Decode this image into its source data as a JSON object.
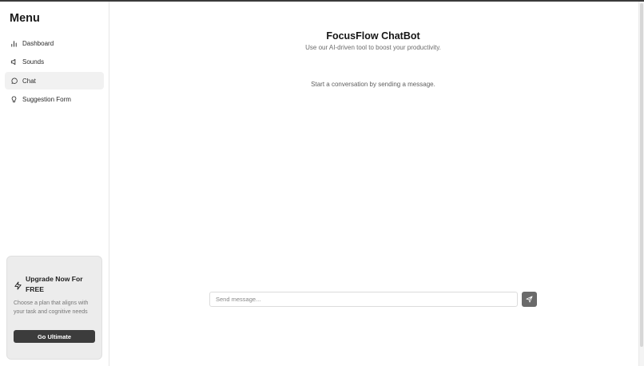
{
  "sidebar": {
    "title": "Menu",
    "items": [
      {
        "label": "Dashboard",
        "icon": "bar-chart-icon"
      },
      {
        "label": "Sounds",
        "icon": "speaker-icon"
      },
      {
        "label": "Chat",
        "icon": "message-circle-icon",
        "active": true
      },
      {
        "label": "Suggestion Form",
        "icon": "lightbulb-icon"
      }
    ],
    "upgrade": {
      "title": "Upgrade Now For FREE",
      "description": "Choose a plan that aligns with your task and cognitive needs",
      "button_label": "Go Ultimate",
      "icon": "bolt-icon"
    }
  },
  "chat": {
    "title": "FocusFlow ChatBot",
    "subtitle": "Use our AI-driven tool to boost your productivity.",
    "empty_state": "Start a conversation by sending a message.",
    "input_placeholder": "Send message...",
    "input_value": "",
    "send_icon": "send-icon"
  },
  "colors": {
    "accent_dark": "#3c3c3c",
    "send_button": "#6a6a6a",
    "active_nav_bg": "#f1f1f1",
    "upgrade_card_bg": "#ececec"
  }
}
